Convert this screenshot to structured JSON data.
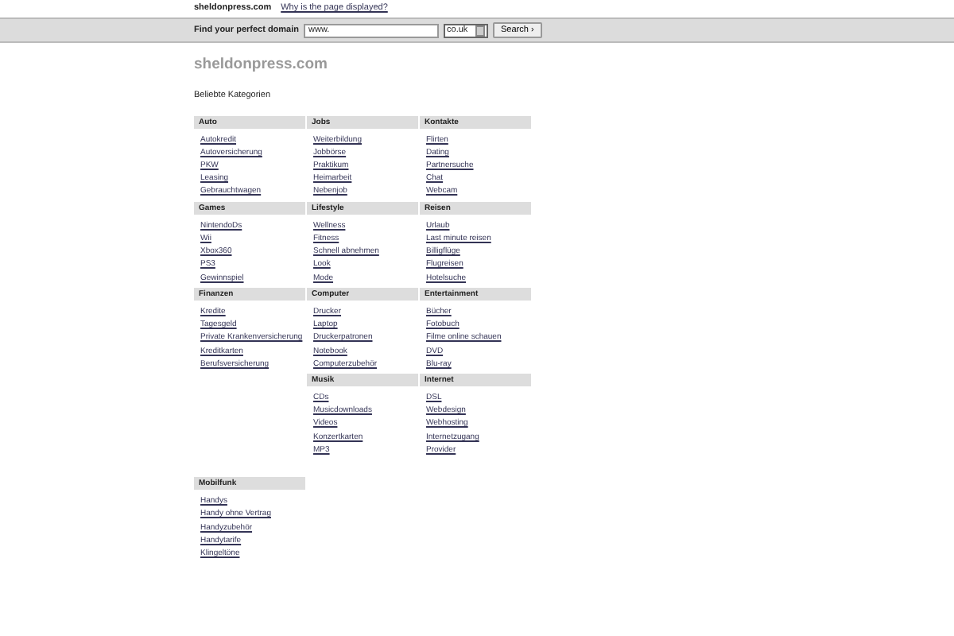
{
  "top_bar": {
    "site": "sheldonpress.com",
    "link": "Why is the page displayed?"
  },
  "search_bar": {
    "label": "Find your perfect domain",
    "value": "www.",
    "tld": "co.uk",
    "button": "Search",
    "button_icon": "›"
  },
  "title": "sheldonpress.com",
  "subtitle": "Beliebte Kategorien",
  "category_groups": [
    {
      "columns": [
        [
          {
            "name": "Auto",
            "links": [
              "Autokredit",
              "Autoversicherung",
              "PKW",
              "Leasing",
              "Gebrauchtwagen"
            ]
          },
          {
            "name": "Games",
            "links": [
              "NintendoDs",
              "Wii",
              "Xbox360",
              "PS3",
              "Gewinnspiel"
            ]
          },
          {
            "name": "Finanzen",
            "links": [
              "Kredite",
              "Tagesgeld",
              "Private Krankenversicherung",
              "Kreditkarten",
              "Berufsversicherung"
            ]
          }
        ],
        [
          {
            "name": "Jobs",
            "links": [
              "Weiterbildung",
              "Jobbörse",
              "Praktikum",
              "Heimarbeit",
              "Nebenjob"
            ]
          },
          {
            "name": "Lifestyle",
            "links": [
              "Wellness",
              "Fitness",
              "Schnell abnehmen",
              "Look",
              "Mode"
            ]
          },
          {
            "name": "Computer",
            "links": [
              "Drucker",
              "Laptop",
              "Druckerpatronen",
              "Notebook",
              "Computerzubehör"
            ]
          },
          {
            "name": "Musik",
            "links": [
              "CDs",
              "Musicdownloads",
              "Videos",
              "Konzertkarten",
              "MP3"
            ]
          }
        ],
        [
          {
            "name": "Kontakte",
            "links": [
              "Flirten",
              "Dating",
              "Partnersuche",
              "Chat",
              "Webcam"
            ]
          },
          {
            "name": "Reisen",
            "links": [
              "Urlaub",
              "Last minute reisen",
              "Billigflüge",
              "Flugreisen",
              "Hotelsuche"
            ]
          },
          {
            "name": "Entertainment",
            "links": [
              "Bücher",
              "Fotobuch",
              "Filme online schauen",
              "DVD",
              "Blu-ray"
            ]
          },
          {
            "name": "Internet",
            "links": [
              "DSL",
              "Webdesign",
              "Webhosting",
              "Internetzugang",
              "Provider"
            ]
          }
        ]
      ]
    },
    {
      "columns": [
        [
          {
            "name": "Mobilfunk",
            "links": [
              "Handys",
              "Handy ohne Vertrag",
              "Handyzubehör",
              "Handytarife",
              "Klingeltöne"
            ]
          }
        ]
      ]
    }
  ]
}
